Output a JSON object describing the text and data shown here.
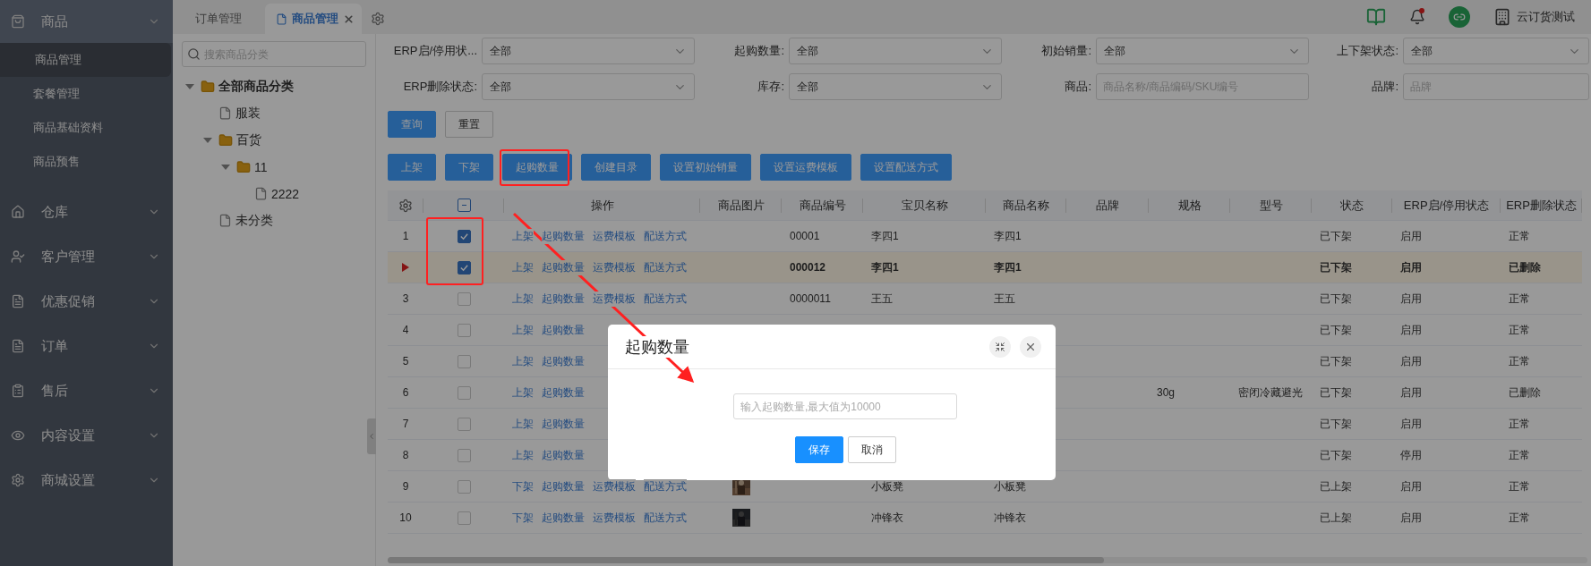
{
  "sidebar": {
    "groups": [
      {
        "label": "商品",
        "expanded": true,
        "items": [
          {
            "label": "商品管理",
            "selected": true
          },
          {
            "label": "套餐管理",
            "selected": false
          },
          {
            "label": "商品基础资料",
            "selected": false
          },
          {
            "label": "商品预售",
            "selected": false
          }
        ]
      },
      {
        "label": "仓库",
        "expanded": false
      },
      {
        "label": "客户管理",
        "expanded": false
      },
      {
        "label": "优惠促销",
        "expanded": false
      },
      {
        "label": "订单",
        "expanded": false
      },
      {
        "label": "售后",
        "expanded": false
      },
      {
        "label": "内容设置",
        "expanded": false
      },
      {
        "label": "商城设置",
        "expanded": false
      }
    ]
  },
  "tabs": [
    {
      "label": "订单管理",
      "selected": false
    },
    {
      "label": "商品管理",
      "selected": true
    }
  ],
  "header": {
    "notification": true,
    "user": "云订货测试"
  },
  "category_tree": {
    "search_placeholder": "搜索商品分类",
    "nodes": [
      {
        "label": "全部商品分类",
        "kind": "folder",
        "expanded": true,
        "children": [
          {
            "label": "服装",
            "kind": "file"
          },
          {
            "label": "百货",
            "kind": "folder",
            "expanded": true,
            "children": [
              {
                "label": "11",
                "kind": "folder",
                "expanded": true,
                "children": [
                  {
                    "label": "2222",
                    "kind": "file"
                  }
                ]
              }
            ]
          },
          {
            "label": "未分类",
            "kind": "file"
          }
        ]
      }
    ]
  },
  "filters": [
    {
      "label": "ERP启/停用状...",
      "kind": "select",
      "value": "全部"
    },
    {
      "label": "起购数量:",
      "kind": "select",
      "value": "全部"
    },
    {
      "label": "初始销量:",
      "kind": "select",
      "value": "全部"
    },
    {
      "label": "上下架状态:",
      "kind": "select",
      "value": "全部"
    },
    {
      "label": "ERP删除状态:",
      "kind": "select",
      "value": "全部"
    },
    {
      "label": "库存:",
      "kind": "select",
      "value": "全部"
    },
    {
      "label": "商品:",
      "kind": "input",
      "placeholder": "商品名称/商品编码/SKU编号"
    },
    {
      "label": "品牌:",
      "kind": "input",
      "placeholder": "品牌"
    }
  ],
  "filter_buttons": [
    {
      "label": "查询",
      "kind": "primary"
    },
    {
      "label": "重置",
      "kind": "default"
    }
  ],
  "actions": [
    "上架",
    "下架",
    "起购数量",
    "创建目录",
    "设置初始销量",
    "设置运费模板",
    "设置配送方式"
  ],
  "table": {
    "header_checkbox": {
      "indeterminate": true
    },
    "columns": [
      "操作",
      "商品图片",
      "商品编号",
      "宝贝名称",
      "商品名称",
      "品牌",
      "规格",
      "型号",
      "状态",
      "ERP启/停用状态",
      "ERP删除状态"
    ],
    "rows": [
      {
        "index": "1",
        "checked": true,
        "current": false,
        "ops": [
          "上架",
          "起购数量",
          "运费模板",
          "配送方式"
        ],
        "code": "00001",
        "item_name": "李四1",
        "product_name": "李四1",
        "status": "已下架",
        "erp_enabled": "启用",
        "erp_deleted": "正常"
      },
      {
        "checked": true,
        "current": true,
        "ops": [
          "上架",
          "起购数量",
          "运费模板",
          "配送方式"
        ],
        "code": "000012",
        "item_name": "李四1",
        "product_name": "李四1",
        "status": "已下架",
        "erp_enabled": "启用",
        "erp_deleted": "已删除"
      },
      {
        "index": "3",
        "checked": false,
        "current": false,
        "ops": [
          "上架",
          "起购数量",
          "运费模板",
          "配送方式"
        ],
        "code": "0000011",
        "item_name": "王五",
        "product_name": "王五",
        "status": "已下架",
        "erp_enabled": "启用",
        "erp_deleted": "正常"
      },
      {
        "index": "4",
        "checked": false,
        "current": false,
        "ops": [
          "上架",
          "起购数量"
        ],
        "status": "已下架",
        "erp_enabled": "启用",
        "erp_deleted": "正常"
      },
      {
        "index": "5",
        "checked": false,
        "current": false,
        "ops": [
          "上架",
          "起购数量"
        ],
        "status": "已下架",
        "erp_enabled": "启用",
        "erp_deleted": "正常"
      },
      {
        "index": "6",
        "checked": false,
        "current": false,
        "ops": [
          "上架",
          "起购数量"
        ],
        "spec": "30g",
        "model": "密闭冷藏避光",
        "status": "已下架",
        "erp_enabled": "启用",
        "erp_deleted": "已删除"
      },
      {
        "index": "7",
        "checked": false,
        "current": false,
        "ops": [
          "上架",
          "起购数量"
        ],
        "status": "已下架",
        "erp_enabled": "启用",
        "erp_deleted": "正常"
      },
      {
        "index": "8",
        "checked": false,
        "current": false,
        "ops": [
          "上架",
          "起购数量"
        ],
        "status": "已下架",
        "erp_enabled": "停用",
        "erp_deleted": "正常"
      },
      {
        "index": "9",
        "checked": false,
        "current": false,
        "ops": [
          "下架",
          "起购数量",
          "运费模板",
          "配送方式"
        ],
        "picture": true,
        "item_name": "小板凳",
        "product_name": "小板凳",
        "status": "已上架",
        "erp_enabled": "启用",
        "erp_deleted": "正常"
      },
      {
        "index": "10",
        "checked": false,
        "current": false,
        "ops": [
          "下架",
          "起购数量",
          "运费模板",
          "配送方式"
        ],
        "picture": true,
        "item_name": "冲锋衣",
        "product_name": "冲锋衣",
        "status": "已上架",
        "erp_enabled": "启用",
        "erp_deleted": "正常"
      }
    ]
  },
  "modal": {
    "title": "起购数量",
    "input_placeholder": "输入起购数量,最大值为10000",
    "buttons": [
      {
        "label": "保存",
        "kind": "primary"
      },
      {
        "label": "取消",
        "kind": "default"
      }
    ]
  }
}
